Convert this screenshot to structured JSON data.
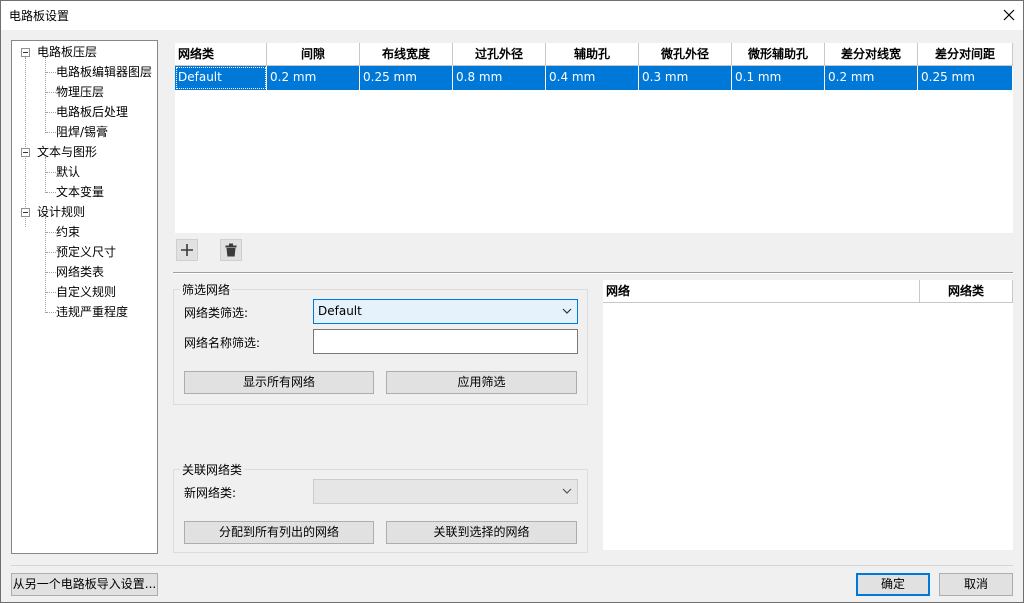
{
  "window": {
    "title": "电路板设置"
  },
  "tree": [
    {
      "label": "电路板压层",
      "level": 0,
      "expanded": true
    },
    {
      "label": "电路板编辑器图层",
      "level": 1
    },
    {
      "label": "物理压层",
      "level": 1
    },
    {
      "label": "电路板后处理",
      "level": 1
    },
    {
      "label": "阻焊/锡膏",
      "level": 1
    },
    {
      "label": "文本与图形",
      "level": 0,
      "expanded": true
    },
    {
      "label": "默认",
      "level": 1
    },
    {
      "label": "文本变量",
      "level": 1
    },
    {
      "label": "设计规则",
      "level": 0,
      "expanded": true
    },
    {
      "label": "约束",
      "level": 1
    },
    {
      "label": "预定义尺寸",
      "level": 1
    },
    {
      "label": "网络类表",
      "level": 1
    },
    {
      "label": "自定义规则",
      "level": 1
    },
    {
      "label": "违规严重程度",
      "level": 1
    }
  ],
  "netclass_grid": {
    "columns": [
      "网络类",
      "间隙",
      "布线宽度",
      "过孔外径",
      "辅助孔",
      "微孔外径",
      "微形辅助孔",
      "差分对线宽",
      "差分对间距"
    ],
    "rows": [
      [
        "Default",
        "0.2 mm",
        "0.25 mm",
        "0.8 mm",
        "0.4 mm",
        "0.3 mm",
        "0.1 mm",
        "0.2 mm",
        "0.25 mm"
      ]
    ]
  },
  "filter": {
    "group_title": "筛选网络",
    "netclass_label": "网络类筛选:",
    "netclass_value": "Default",
    "netname_label": "网络名称筛选:",
    "netname_value": "",
    "show_all_button": "显示所有网络",
    "apply_button": "应用筛选"
  },
  "assign": {
    "group_title": "关联网络类",
    "new_class_label": "新网络类:",
    "new_class_value": "",
    "assign_all_button": "分配到所有列出的网络",
    "assign_selected_button": "关联到选择的网络"
  },
  "net_list": {
    "columns": [
      "网络",
      "网络类"
    ]
  },
  "footer": {
    "import_button": "从另一个电路板导入设置...",
    "ok_button": "确定",
    "cancel_button": "取消"
  }
}
